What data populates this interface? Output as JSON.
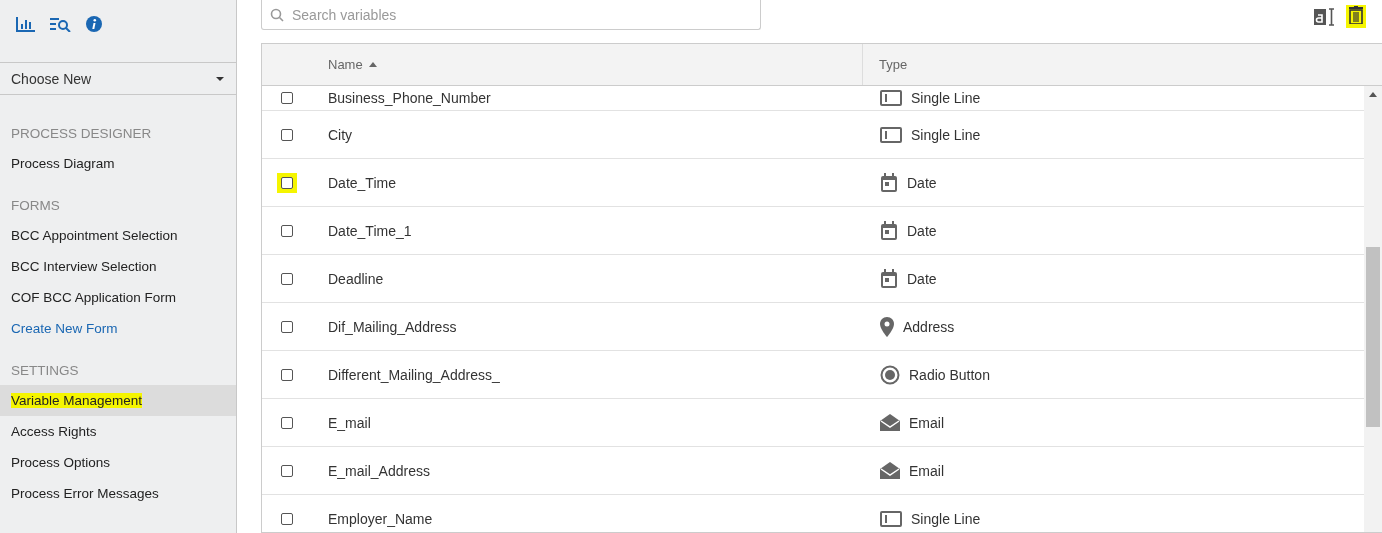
{
  "sidebar": {
    "dropdown": {
      "value": "Choose New"
    },
    "sections": [
      {
        "heading": "PROCESS DESIGNER",
        "items": [
          {
            "label": "Process Diagram",
            "kind": "item",
            "selected": false,
            "highlighted": false
          }
        ]
      },
      {
        "heading": "FORMS",
        "items": [
          {
            "label": "BCC Appointment Selection",
            "kind": "item",
            "selected": false,
            "highlighted": false
          },
          {
            "label": "BCC Interview Selection",
            "kind": "item",
            "selected": false,
            "highlighted": false
          },
          {
            "label": "COF BCC Application Form",
            "kind": "item",
            "selected": false,
            "highlighted": false
          },
          {
            "label": "Create New Form",
            "kind": "link",
            "selected": false,
            "highlighted": false
          }
        ]
      },
      {
        "heading": "SETTINGS",
        "items": [
          {
            "label": "Variable Management",
            "kind": "item",
            "selected": true,
            "highlighted": true
          },
          {
            "label": "Access Rights",
            "kind": "item",
            "selected": false,
            "highlighted": false
          },
          {
            "label": "Process Options",
            "kind": "item",
            "selected": false,
            "highlighted": false
          },
          {
            "label": "Process Error Messages",
            "kind": "item",
            "selected": false,
            "highlighted": false
          }
        ]
      }
    ]
  },
  "search": {
    "placeholder": "Search variables"
  },
  "toolbar": {
    "delete_highlighted": true
  },
  "table": {
    "columns": [
      {
        "label": "Name",
        "sorted": true
      },
      {
        "label": "Type",
        "sorted": false
      }
    ],
    "rows": [
      {
        "name": "Business_Phone_Number",
        "type": "Single Line",
        "kind": "single_line",
        "checked": false,
        "highlighted": false
      },
      {
        "name": "City",
        "type": "Single Line",
        "kind": "single_line",
        "checked": false,
        "highlighted": false
      },
      {
        "name": "Date_Time",
        "type": "Date",
        "kind": "date",
        "checked": false,
        "highlighted": true
      },
      {
        "name": "Date_Time_1",
        "type": "Date",
        "kind": "date",
        "checked": false,
        "highlighted": false
      },
      {
        "name": "Deadline",
        "type": "Date",
        "kind": "date",
        "checked": false,
        "highlighted": false
      },
      {
        "name": "Dif_Mailing_Address",
        "type": "Address",
        "kind": "address",
        "checked": false,
        "highlighted": false
      },
      {
        "name": "Different_Mailing_Address_",
        "type": "Radio Button",
        "kind": "radio",
        "checked": false,
        "highlighted": false
      },
      {
        "name": "E_mail",
        "type": "Email",
        "kind": "email",
        "checked": false,
        "highlighted": false
      },
      {
        "name": "E_mail_Address",
        "type": "Email",
        "kind": "email",
        "checked": false,
        "highlighted": false
      },
      {
        "name": "Employer_Name",
        "type": "Single Line",
        "kind": "single_line",
        "checked": false,
        "highlighted": false
      }
    ]
  }
}
